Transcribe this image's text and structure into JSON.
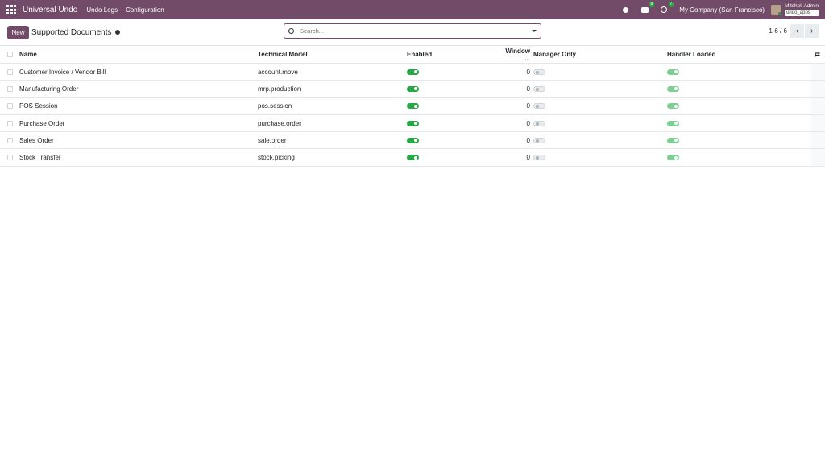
{
  "navbar": {
    "brand": "Universal Undo",
    "menu": [
      "Undo Logs",
      "Configuration"
    ],
    "messages_count": "8",
    "activities_count": "7",
    "company": "My Company (San Francisco)",
    "user_name": "Mitchell Admin",
    "database": "undo_apps"
  },
  "control": {
    "new_label": "New",
    "title": "Supported Documents",
    "search_placeholder": "Search...",
    "pager": "1-6 / 6"
  },
  "columns": {
    "name": "Name",
    "model": "Technical Model",
    "enabled": "Enabled",
    "window": "Window ...",
    "manager": "Manager Only",
    "handler": "Handler Loaded"
  },
  "rows": [
    {
      "name": "Customer Invoice / Vendor Bill",
      "model": "account.move",
      "enabled": true,
      "window": "0",
      "manager": false,
      "handler": true
    },
    {
      "name": "Manufacturing Order",
      "model": "mrp.production",
      "enabled": true,
      "window": "0",
      "manager": false,
      "handler": true
    },
    {
      "name": "POS Session",
      "model": "pos.session",
      "enabled": true,
      "window": "0",
      "manager": false,
      "handler": true
    },
    {
      "name": "Purchase Order",
      "model": "purchase.order",
      "enabled": true,
      "window": "0",
      "manager": false,
      "handler": true
    },
    {
      "name": "Sales Order",
      "model": "sale.order",
      "enabled": true,
      "window": "0",
      "manager": false,
      "handler": true
    },
    {
      "name": "Stock Transfer",
      "model": "stock.picking",
      "enabled": true,
      "window": "0",
      "manager": false,
      "handler": true
    }
  ],
  "colors": {
    "brand": "#714B67",
    "toggle_on": "#28a745"
  }
}
